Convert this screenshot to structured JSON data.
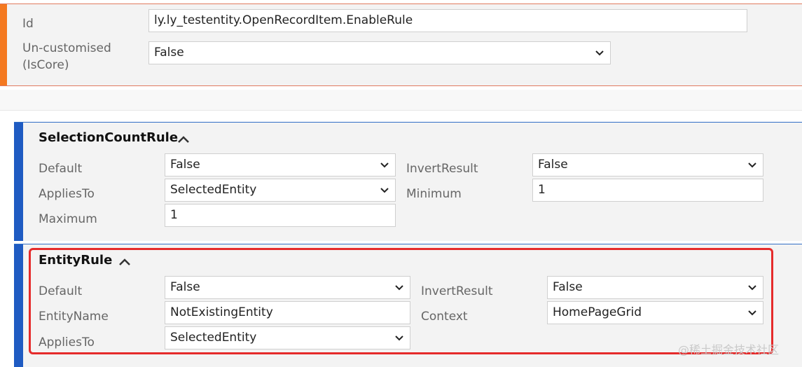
{
  "header": {
    "id_label": "Id",
    "id_value": "ly.ly_testentity.OpenRecordItem.EnableRule",
    "uncustomised_label_line1": "Un-customised",
    "uncustomised_label_line2": "(IsCore)",
    "uncustomised_value": "False"
  },
  "selection_count_rule": {
    "title": "SelectionCountRule",
    "default_label": "Default",
    "default_value": "False",
    "invert_label": "InvertResult",
    "invert_value": "False",
    "applies_label": "AppliesTo",
    "applies_value": "SelectedEntity",
    "minimum_label": "Minimum",
    "minimum_value": "1",
    "maximum_label": "Maximum",
    "maximum_value": "1"
  },
  "entity_rule": {
    "title": "EntityRule",
    "default_label": "Default",
    "default_value": "False",
    "invert_label": "InvertResult",
    "invert_value": "False",
    "entityname_label": "EntityName",
    "entityname_value": "NotExistingEntity",
    "context_label": "Context",
    "context_value": "HomePageGrid",
    "applies_label": "AppliesTo",
    "applies_value": "SelectedEntity"
  },
  "icons": {
    "dropdown": "chevron-down-icon",
    "collapse": "chevron-up-icon"
  },
  "colors": {
    "top_accent": "#f47920",
    "section_accent": "#1f5bc2",
    "highlight": "#e52b2b"
  },
  "watermark": "@稀土掘金技术社区"
}
